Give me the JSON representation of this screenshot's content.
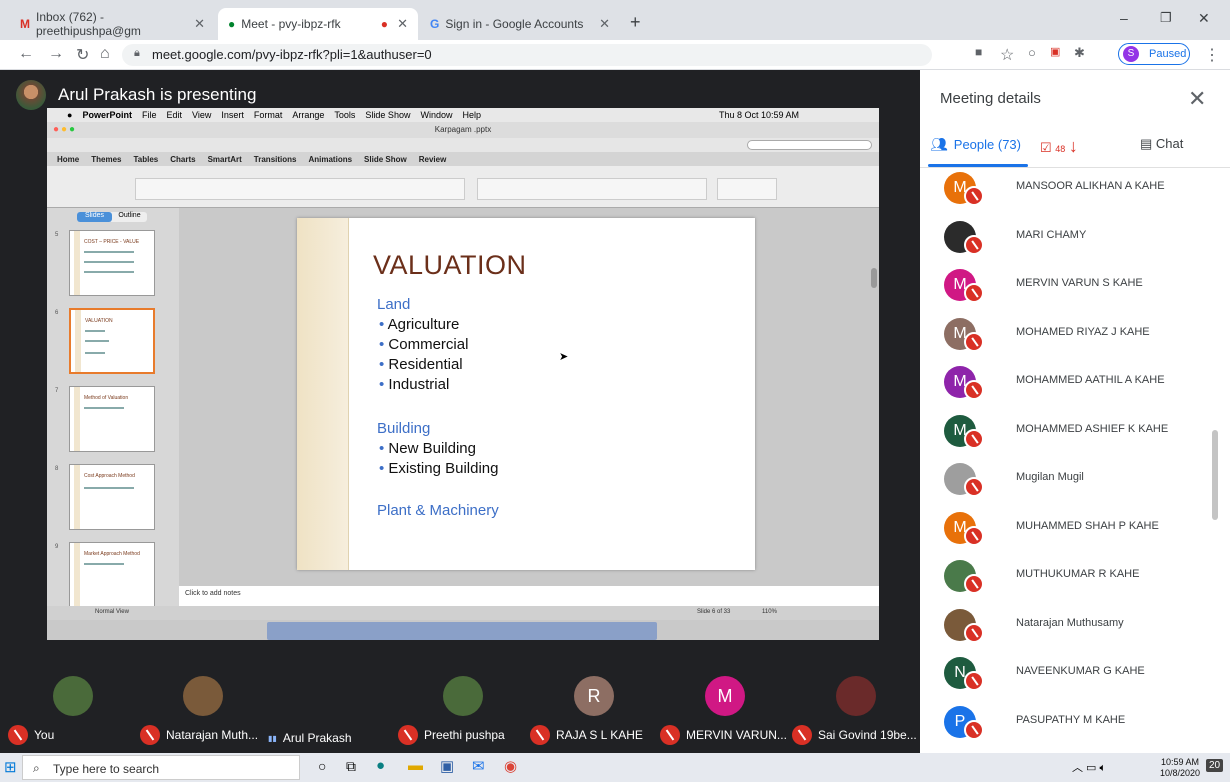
{
  "browser": {
    "tabs": [
      {
        "icon": "gmail-icon",
        "label": "Inbox (762) - preethipushpa@gm"
      },
      {
        "icon": "meet-icon",
        "label": "Meet - pvy-ibpz-rfk"
      },
      {
        "icon": "google-icon",
        "label": "Sign in - Google Accounts"
      }
    ],
    "url": "meet.google.com/pvy-ibpz-rfk?pli=1&authuser=0",
    "profile_initial": "S",
    "profile_status": "Paused"
  },
  "meet": {
    "presenting_text": "Arul Prakash is presenting"
  },
  "screen": {
    "mac_menu": [
      "PowerPoint",
      "File",
      "Edit",
      "View",
      "Insert",
      "Format",
      "Arrange",
      "Tools",
      "Slide Show",
      "Window",
      "Help"
    ],
    "mac_clock": "Thu 8 Oct 10:59 AM",
    "file_name": "Karpagam .pptx",
    "ribbon_tabs": [
      "Home",
      "Themes",
      "Tables",
      "Charts",
      "SmartArt",
      "Transitions",
      "Animations",
      "Slide Show",
      "Review"
    ],
    "pane_tabs": [
      "Slides",
      "Outline"
    ],
    "thumbnails": [
      {
        "num": "5",
        "title": "COST – PRICE - VALUE"
      },
      {
        "num": "6",
        "title": "VALUATION"
      },
      {
        "num": "7",
        "title": "Method of Valuation"
      },
      {
        "num": "8",
        "title": "Cost Approach Method"
      },
      {
        "num": "9",
        "title": "Market Approach Method"
      }
    ],
    "slide": {
      "title": "VALUATION",
      "sections": [
        {
          "heading": "Land",
          "items": [
            "Agriculture",
            "Commercial",
            "Residential",
            "Industrial"
          ]
        },
        {
          "heading": "Building",
          "items": [
            "New Building",
            "Existing Building"
          ]
        },
        {
          "heading": "Plant & Machinery",
          "items": []
        }
      ]
    },
    "notes_placeholder": "Click to add notes",
    "view_label": "Normal View",
    "slide_counter": "Slide 6 of 33",
    "zoom": "110%"
  },
  "panel": {
    "title": "Meeting details",
    "tab_people": "People (73)",
    "tab_tasks_count": "48",
    "tab_chat": "Chat",
    "participants": [
      {
        "name": "MANSOOR ALIKHAN A KAHE",
        "initial": "M",
        "color": "#e8710a"
      },
      {
        "name": "MARI CHAMY",
        "initial": "",
        "color": "#2b2b2b"
      },
      {
        "name": "MERVIN VARUN S KAHE",
        "initial": "M",
        "color": "#d01884"
      },
      {
        "name": "MOHAMED RIYAZ J KAHE",
        "initial": "M",
        "color": "#8d6e63"
      },
      {
        "name": "MOHAMMED AATHIL A KAHE",
        "initial": "M",
        "color": "#8e24aa"
      },
      {
        "name": "MOHAMMED ASHIEF K KAHE",
        "initial": "M",
        "color": "#1e5b3f"
      },
      {
        "name": "Mugilan Mugil",
        "initial": "",
        "color": "#9e9e9e"
      },
      {
        "name": "MUHAMMED SHAH P KAHE",
        "initial": "M",
        "color": "#e8710a"
      },
      {
        "name": "MUTHUKUMAR R KAHE",
        "initial": "",
        "color": "#4a7a4a"
      },
      {
        "name": "Natarajan Muthusamy",
        "initial": "",
        "color": "#7a5a3a"
      },
      {
        "name": "NAVEENKUMAR G KAHE",
        "initial": "N",
        "color": "#1e5b3f"
      },
      {
        "name": "PASUPATHY M KAHE",
        "initial": "P",
        "color": "#1a73e8"
      }
    ]
  },
  "strip": {
    "tiles": [
      {
        "label": "You",
        "initial": "",
        "color": "#4a6a3a",
        "muted": true
      },
      {
        "label": "Natarajan Muth...",
        "initial": "",
        "color": "#7a5a3a",
        "muted": true
      },
      {
        "label": "Arul Prakash",
        "initial": "",
        "color": "",
        "muted": false
      },
      {
        "label": "Preethi pushpa",
        "initial": "",
        "color": "#4a6a3a",
        "muted": true
      },
      {
        "label": "RAJA S L KAHE",
        "initial": "R",
        "color": "#8d6e63",
        "muted": true
      },
      {
        "label": "MERVIN VARUN...",
        "initial": "M",
        "color": "#d01884",
        "muted": true
      },
      {
        "label": "Sai Govind 19be...",
        "initial": "",
        "color": "#6a2a2a",
        "muted": true
      }
    ]
  },
  "taskbar": {
    "search_placeholder": "Type here to search",
    "time": "10:59 AM",
    "date": "10/8/2020",
    "notif_count": "20"
  }
}
